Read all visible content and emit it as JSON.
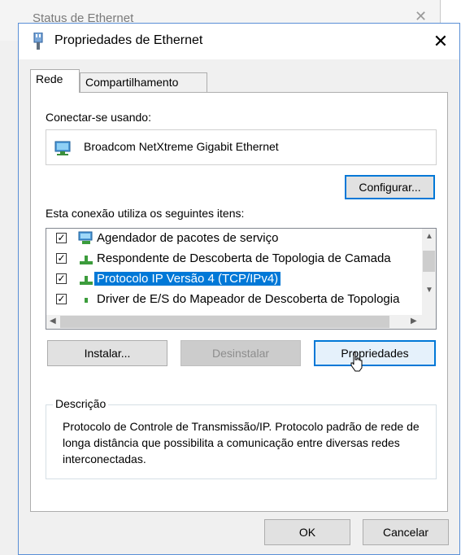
{
  "background_window": {
    "title": "Status de Ethernet"
  },
  "dialog": {
    "title": "Propriedades de Ethernet",
    "tabs": [
      {
        "label": "Rede",
        "active": true
      },
      {
        "label": "Compartilhamento",
        "active": false
      }
    ],
    "connect_using_label": "Conectar-se usando:",
    "adapter_name": "Broadcom NetXtreme Gigabit Ethernet",
    "configure_button": "Configurar...",
    "items_label": "Esta conexão utiliza os seguintes itens:",
    "items": [
      {
        "label": "Agendador de pacotes de serviço",
        "checked": true,
        "selected": false,
        "icon": "network-service-icon"
      },
      {
        "label": "Respondente de Descoberta de Topologia de Camada",
        "checked": true,
        "selected": false,
        "icon": "protocol-icon"
      },
      {
        "label": "Protocolo IP Versão 4 (TCP/IPv4)",
        "checked": true,
        "selected": true,
        "icon": "protocol-icon"
      },
      {
        "label": "Driver de E/S do Mapeador de Descoberta de Topologia",
        "checked": true,
        "selected": false,
        "icon": "protocol-icon"
      }
    ],
    "install_button": "Instalar...",
    "uninstall_button": "Desinstalar",
    "properties_button": "Propriedades",
    "description_title": "Descrição",
    "description_text": "Protocolo de Controle de Transmissão/IP. Protocolo padrão de rede de longa distância que possibilita a comunicação entre diversas redes interconectadas.",
    "ok_button": "OK",
    "cancel_button": "Cancelar"
  },
  "colors": {
    "accent": "#0078d7",
    "selection": "#0078d7",
    "disabled_text": "#8d8d8d"
  }
}
